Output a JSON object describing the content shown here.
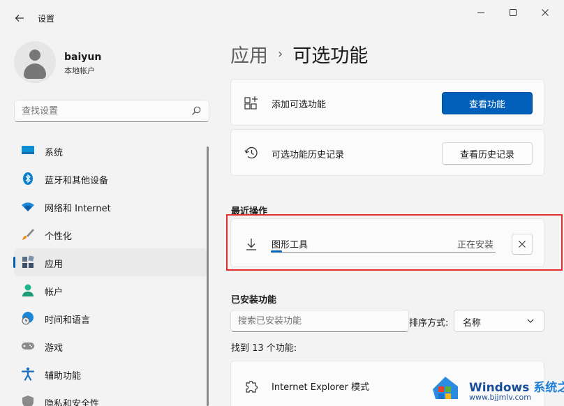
{
  "window": {
    "title": "设置",
    "back_icon": "back-arrow-icon",
    "controls": [
      "minimize-icon",
      "maximize-icon",
      "close-icon"
    ]
  },
  "profile": {
    "name": "baiyun",
    "account_type": "本地帐户"
  },
  "search": {
    "placeholder": "查找设置"
  },
  "nav": {
    "items": [
      {
        "label": "系统",
        "icon": "monitor-icon"
      },
      {
        "label": "蓝牙和其他设备",
        "icon": "bluetooth-icon"
      },
      {
        "label": "网络和 Internet",
        "icon": "wifi-icon"
      },
      {
        "label": "个性化",
        "icon": "brush-icon"
      },
      {
        "label": "应用",
        "icon": "apps-icon",
        "active": true
      },
      {
        "label": "帐户",
        "icon": "account-icon"
      },
      {
        "label": "时间和语言",
        "icon": "globe-clock-icon"
      },
      {
        "label": "游戏",
        "icon": "gamepad-icon"
      },
      {
        "label": "辅助功能",
        "icon": "accessibility-icon"
      },
      {
        "label": "隐私和安全性",
        "icon": "shield-icon"
      }
    ]
  },
  "main": {
    "breadcrumb": {
      "parent": "应用",
      "separator": "›",
      "current": "可选功能"
    },
    "add_feature": {
      "label": "添加可选功能",
      "button": "查看功能"
    },
    "history": {
      "label": "可选功能历史记录",
      "button": "查看历史记录"
    },
    "recent": {
      "title": "最近操作",
      "item": {
        "name": "图形工具",
        "status": "正在安装",
        "progress": 0.05
      }
    },
    "installed": {
      "title": "已安装功能",
      "search_placeholder": "搜索已安装功能",
      "sort_label": "排序方式:",
      "sort_value": "名称",
      "found_text": "找到 13 个功能:",
      "items": [
        {
          "name": "Internet Explorer 模式"
        }
      ]
    }
  },
  "watermark": {
    "brand": "Windows",
    "brand_suffix": "系统之家",
    "url": "www.bjjmlv.com"
  },
  "colors": {
    "accent": "#005fb8",
    "highlight_border": "#e0302b"
  }
}
